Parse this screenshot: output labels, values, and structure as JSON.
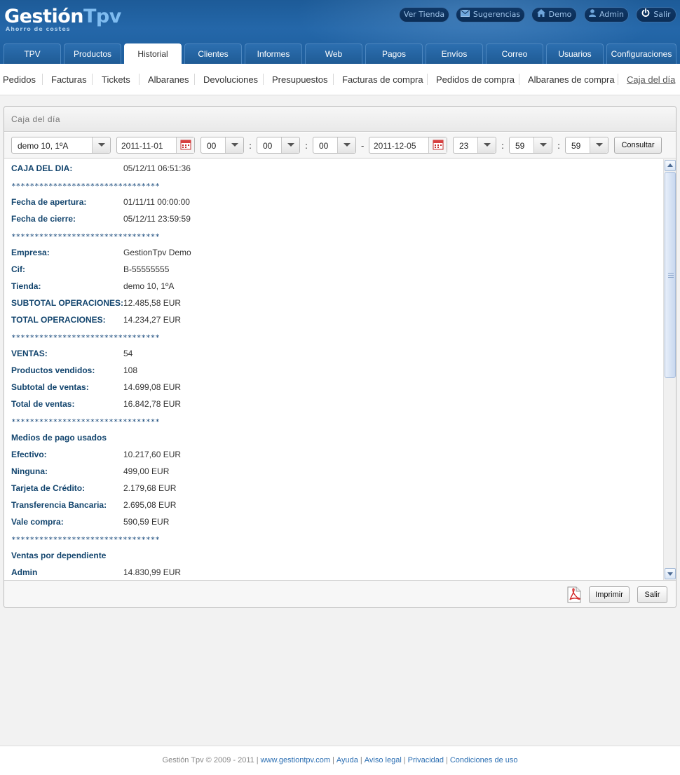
{
  "logo": {
    "brand_a": "Gestión",
    "brand_b": "Tpv",
    "tagline": "Ahorro de costes"
  },
  "top_links": {
    "ver_tienda": "Ver Tienda",
    "sugerencias": "Sugerencias",
    "demo": "Demo",
    "admin": "Admin",
    "salir": "Salir"
  },
  "main_tabs": [
    "TPV",
    "Productos",
    "Historial",
    "Clientes",
    "Informes",
    "Web",
    "Pagos",
    "Envíos",
    "Correo",
    "Usuarios",
    "Configuraciones"
  ],
  "active_main_tab": "Historial",
  "sub_nav": [
    "Pedidos",
    "Facturas",
    "Tickets",
    "Albaranes",
    "Devoluciones",
    "Presupuestos",
    "Facturas de compra",
    "Pedidos de compra",
    "Albaranes de compra",
    "Caja del día"
  ],
  "active_sub_nav": "Caja del día",
  "panel_title": "Caja del día",
  "filters": {
    "store": "demo 10, 1ºA",
    "date_from": "2011-11-01",
    "hour_from": "00",
    "min_from": "00",
    "sec_from": "00",
    "range_sep": "-",
    "date_to": "2011-12-05",
    "hour_to": "23",
    "min_to": "59",
    "sec_to": "59",
    "time_sep": ":",
    "consultar": "Consultar"
  },
  "report_rows": [
    {
      "k": "CAJA DEL DIA:",
      "v": "05/12/11 06:51:36"
    },
    {
      "sep": "********************************"
    },
    {
      "k": "Fecha de apertura:",
      "v": "01/11/11 00:00:00"
    },
    {
      "k": "Fecha de cierre:",
      "v": "05/12/11 23:59:59"
    },
    {
      "sep": "********************************"
    },
    {
      "k": "Empresa:",
      "v": "GestionTpv Demo"
    },
    {
      "k": "Cif:",
      "v": "B-55555555"
    },
    {
      "k": "Tienda:",
      "v": "demo 10, 1ºA"
    },
    {
      "k": "SUBTOTAL OPERACIONES:",
      "v": "12.485,58 EUR"
    },
    {
      "k": "TOTAL OPERACIONES:",
      "v": "14.234,27 EUR"
    },
    {
      "sep": "********************************"
    },
    {
      "k": "VENTAS:",
      "v": "54"
    },
    {
      "k": "Productos vendidos:",
      "v": "108"
    },
    {
      "k": "Subtotal de ventas:",
      "v": "14.699,08 EUR"
    },
    {
      "k": "Total de ventas:",
      "v": "16.842,78 EUR"
    },
    {
      "sep": "********************************"
    },
    {
      "k": "Medios de pago usados",
      "v": ""
    },
    {
      "k": "Efectivo:",
      "v": "10.217,60 EUR"
    },
    {
      "k": "Ninguna:",
      "v": "499,00 EUR"
    },
    {
      "k": "Tarjeta de Crédito:",
      "v": "2.179,68 EUR"
    },
    {
      "k": "Transferencia Bancaria:",
      "v": "2.695,08 EUR"
    },
    {
      "k": "Vale compra:",
      "v": "590,59 EUR"
    },
    {
      "sep": "********************************"
    },
    {
      "k": "Ventas por dependiente",
      "v": ""
    },
    {
      "k": "Admin",
      "v": "14.830,99 EUR"
    }
  ],
  "actions": {
    "imprimir": "Imprimir",
    "salir": "Salir"
  },
  "footer": {
    "copyright": "Gestión Tpv © 2009 - 2011",
    "site": "www.gestiontpv.com",
    "ayuda": "Ayuda",
    "aviso": "Aviso legal",
    "privacidad": "Privacidad",
    "condiciones": "Condiciones de uso"
  },
  "colors": {
    "header_blue": "#1d5b98",
    "label_blue": "#13456e",
    "link_blue": "#2c6fb3"
  }
}
